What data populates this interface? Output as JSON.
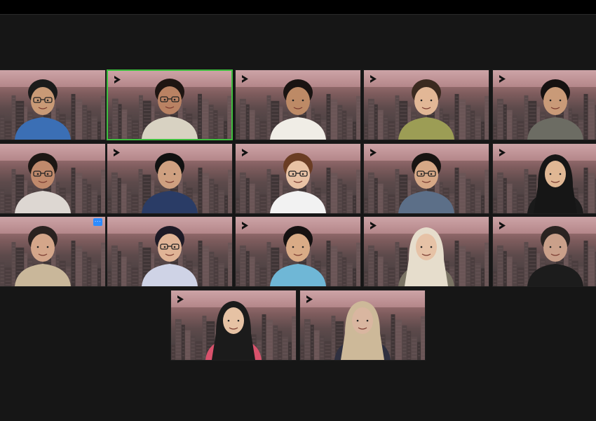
{
  "app": {
    "name": "video-conference-gallery-view"
  },
  "more_button": {
    "label": "···"
  },
  "tiles": [
    {
      "id": "r1c1",
      "active": false,
      "logo": false,
      "skin": "#c99a76",
      "hair": "#1b1b1b",
      "shirt": "#3b6fb5",
      "glasses": true,
      "hijab": false
    },
    {
      "id": "r1c2",
      "active": true,
      "logo": true,
      "skin": "#b98263",
      "hair": "#1e1512",
      "shirt": "#d8d2c2",
      "glasses": true,
      "hijab": false
    },
    {
      "id": "r1c3",
      "active": false,
      "logo": true,
      "skin": "#bd8a66",
      "hair": "#1a1412",
      "shirt": "#f0ede6",
      "glasses": false,
      "hijab": false
    },
    {
      "id": "r1c4",
      "active": false,
      "logo": true,
      "skin": "#e2b796",
      "hair": "#3b2a20",
      "shirt": "#9c9d55",
      "glasses": false,
      "hijab": false
    },
    {
      "id": "r1c5",
      "active": false,
      "logo": true,
      "skin": "#c99a78",
      "hair": "#151111",
      "shirt": "#6c6c63",
      "glasses": false,
      "hijab": false
    },
    {
      "id": "r2c1",
      "active": false,
      "logo": false,
      "skin": "#c08a6c",
      "hair": "#1d1714",
      "shirt": "#ddd7d2",
      "glasses": true,
      "hijab": false
    },
    {
      "id": "r2c2",
      "active": false,
      "logo": true,
      "skin": "#cfa080",
      "hair": "#111",
      "shirt": "#2a3c66",
      "glasses": false,
      "hijab": false
    },
    {
      "id": "r2c3",
      "active": false,
      "logo": true,
      "skin": "#e8c2a4",
      "hair": "#6b3d24",
      "shirt": "#f2f2f2",
      "glasses": true,
      "hijab": false
    },
    {
      "id": "r2c4",
      "active": false,
      "logo": true,
      "skin": "#d6a886",
      "hair": "#181412",
      "shirt": "#5c6f88",
      "glasses": true,
      "hijab": false
    },
    {
      "id": "r2c5",
      "active": false,
      "logo": true,
      "skin": "#e0b794",
      "hair": "#111",
      "shirt": "#1a1a1a",
      "glasses": false,
      "hijab": true,
      "hijab_color": "#161616"
    },
    {
      "id": "r3c1",
      "active": false,
      "logo": false,
      "skin": "#d4a68a",
      "hair": "#2a2220",
      "shirt": "#c9b79a",
      "glasses": false,
      "hijab": false
    },
    {
      "id": "r3c2",
      "active": false,
      "logo": false,
      "skin": "#e0b496",
      "hair": "#1e1a26",
      "shirt": "#cfd3e6",
      "glasses": true,
      "hijab": false
    },
    {
      "id": "r3c3",
      "active": false,
      "logo": true,
      "skin": "#d9ab86",
      "hair": "#151111",
      "shirt": "#6fb7d6",
      "glasses": false,
      "hijab": false
    },
    {
      "id": "r3c4",
      "active": false,
      "logo": true,
      "skin": "#e6c2a6",
      "hair": "#e9dfcf",
      "shirt": "#7a7464",
      "glasses": false,
      "hijab": true,
      "hijab_color": "#e6ddcc"
    },
    {
      "id": "r3c5",
      "active": false,
      "logo": true,
      "skin": "#caa08a",
      "hair": "#2a2321",
      "shirt": "#1c1c1c",
      "glasses": false,
      "hijab": false
    },
    {
      "id": "r4c1",
      "active": false,
      "logo": true,
      "skin": "#e6c2a4",
      "hair": "#111",
      "shirt": "#d9526c",
      "glasses": false,
      "hijab": true,
      "hijab_color": "#1b1b1b"
    },
    {
      "id": "r4c2",
      "active": false,
      "logo": true,
      "skin": "#d9b6a0",
      "hair": "#c9b595",
      "shirt": "#2f3040",
      "glasses": false,
      "hijab": true,
      "hijab_color": "#cdb999"
    }
  ]
}
